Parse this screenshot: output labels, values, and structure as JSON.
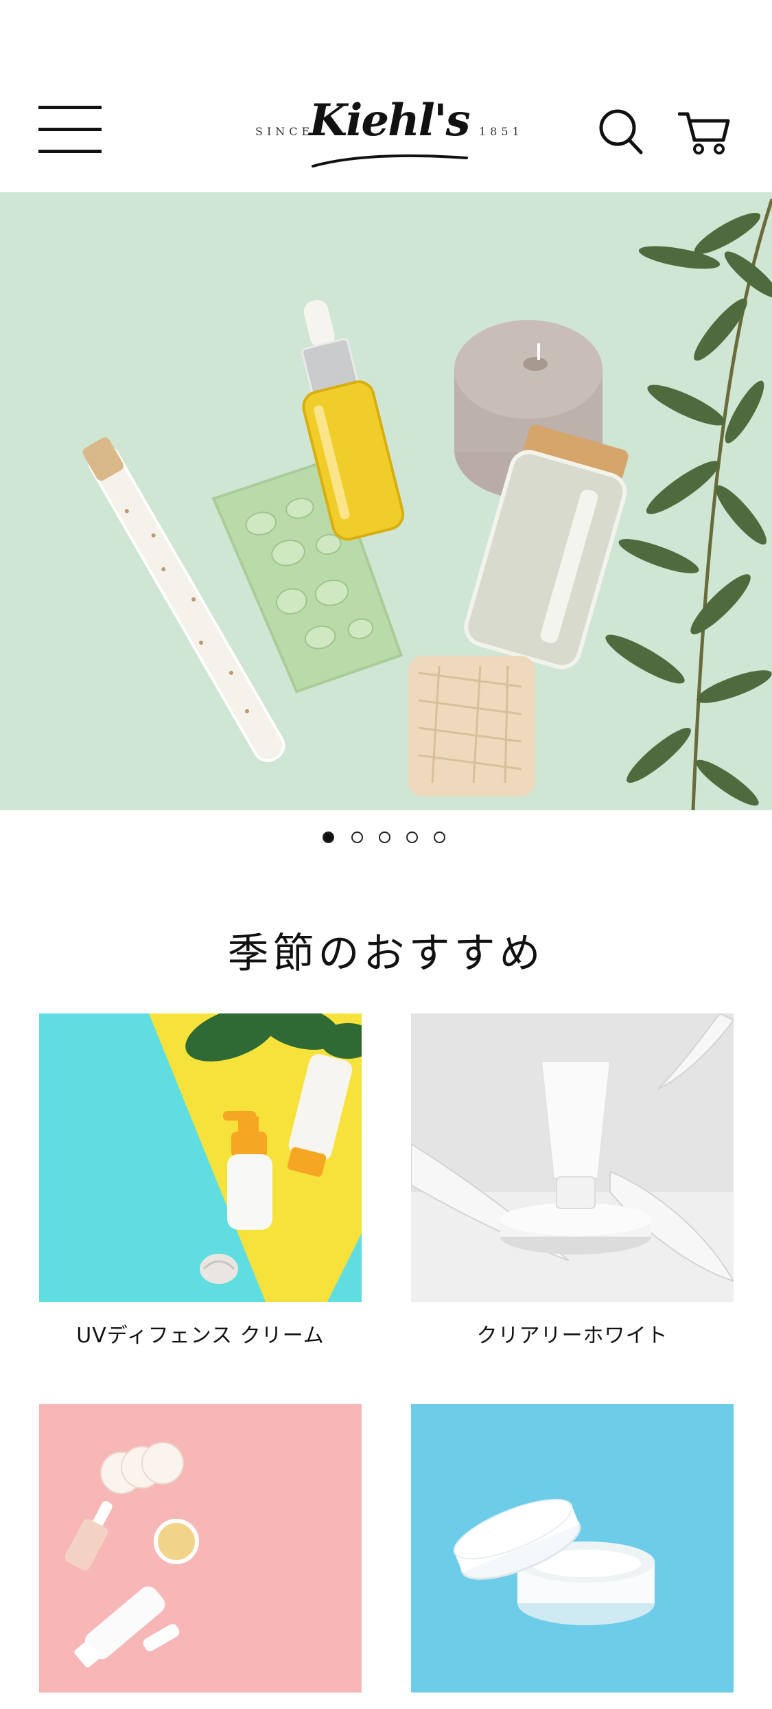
{
  "header": {
    "logo": {
      "since": "SINCE",
      "wordmark": "Kiehl's",
      "year": "1851"
    },
    "icons": {
      "menu": "hamburger-menu-icon",
      "search": "search-icon",
      "cart": "cart-icon"
    }
  },
  "hero": {
    "slide_count": 5,
    "active_slide": 1,
    "background_color": "#cfe6d4"
  },
  "section": {
    "title": "季節のおすすめ"
  },
  "products": [
    {
      "label": "UVディフェンス クリーム"
    },
    {
      "label": "クリアリーホワイト"
    },
    {
      "label": ""
    },
    {
      "label": ""
    }
  ],
  "colors": {
    "text": "#111111",
    "background": "#ffffff",
    "hero_mint": "#cfe6d4",
    "card_cyan": "#5fdde0",
    "card_yellow": "#f6e23a",
    "card_gray": "#e4e4e4",
    "card_pink": "#f7b7b7",
    "card_blue": "#6dcde9"
  }
}
